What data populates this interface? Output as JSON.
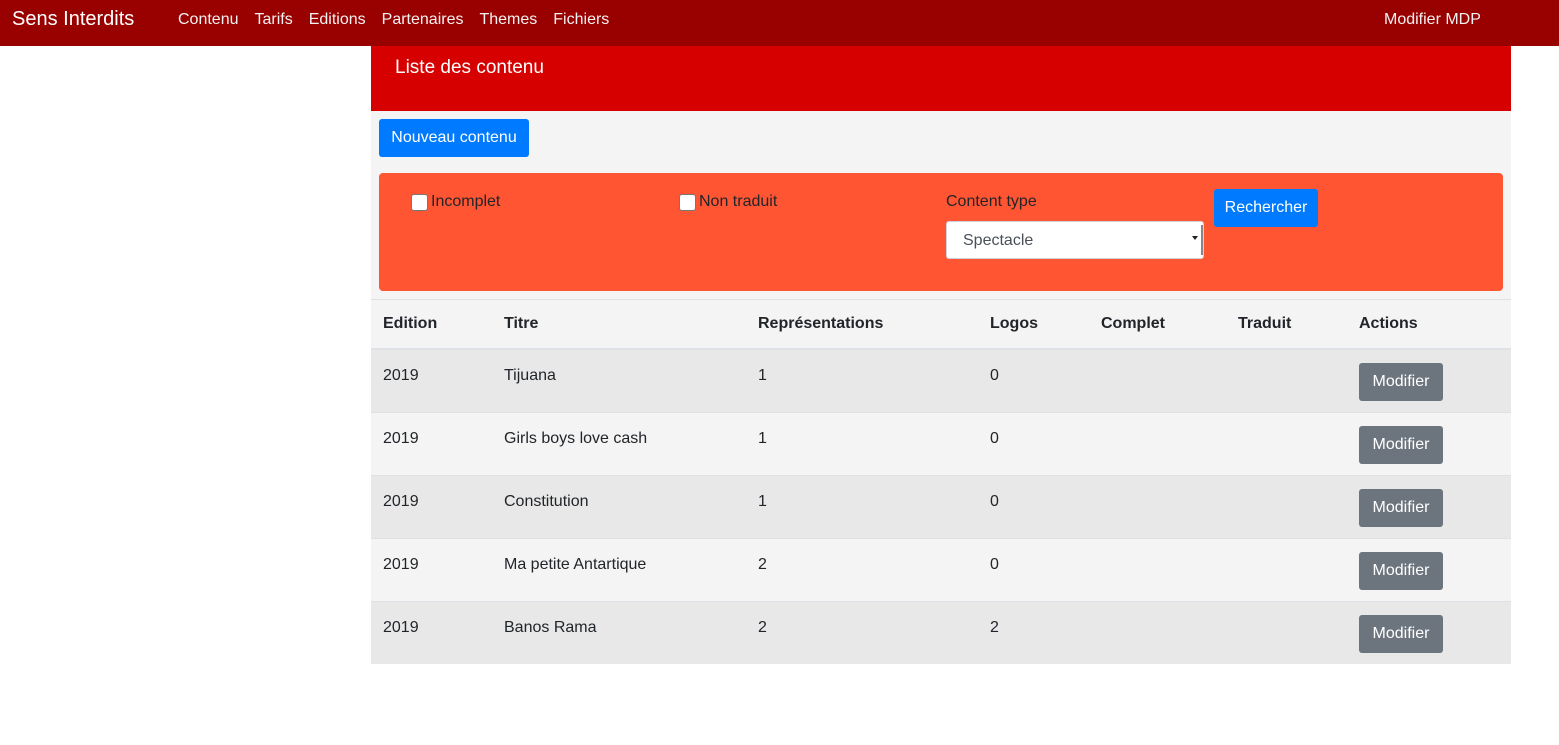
{
  "navbar": {
    "brand": "Sens Interdits",
    "links": [
      "Contenu",
      "Tarifs",
      "Editions",
      "Partenaires",
      "Themes",
      "Fichiers"
    ],
    "right_link": "Modifier MDP",
    "color": "#990000"
  },
  "panel": {
    "title": "Liste des contenu",
    "header_color": "#d60000",
    "new_button": "Nouveau contenu"
  },
  "filters": {
    "incomplete_label": "Incomplet",
    "incomplete_checked": false,
    "untranslated_label": "Non traduit",
    "untranslated_checked": false,
    "content_type_label": "Content type",
    "content_type_value": "Spectacle",
    "search_button": "Rechercher",
    "box_color": "#ff5533"
  },
  "table": {
    "headers": [
      "Edition",
      "Titre",
      "Représentations",
      "Logos",
      "Complet",
      "Traduit",
      "Actions"
    ],
    "action_label": "Modifier",
    "rows": [
      {
        "edition": "2019",
        "titre": "Tijuana",
        "representations": "1",
        "logos": "0",
        "complet": "",
        "traduit": ""
      },
      {
        "edition": "2019",
        "titre": "Girls boys love cash",
        "representations": "1",
        "logos": "0",
        "complet": "",
        "traduit": ""
      },
      {
        "edition": "2019",
        "titre": "Constitution",
        "representations": "1",
        "logos": "0",
        "complet": "",
        "traduit": ""
      },
      {
        "edition": "2019",
        "titre": "Ma petite Antartique",
        "representations": "2",
        "logos": "0",
        "complet": "",
        "traduit": ""
      },
      {
        "edition": "2019",
        "titre": "Banos Rama",
        "representations": "2",
        "logos": "2",
        "complet": "",
        "traduit": ""
      }
    ]
  }
}
